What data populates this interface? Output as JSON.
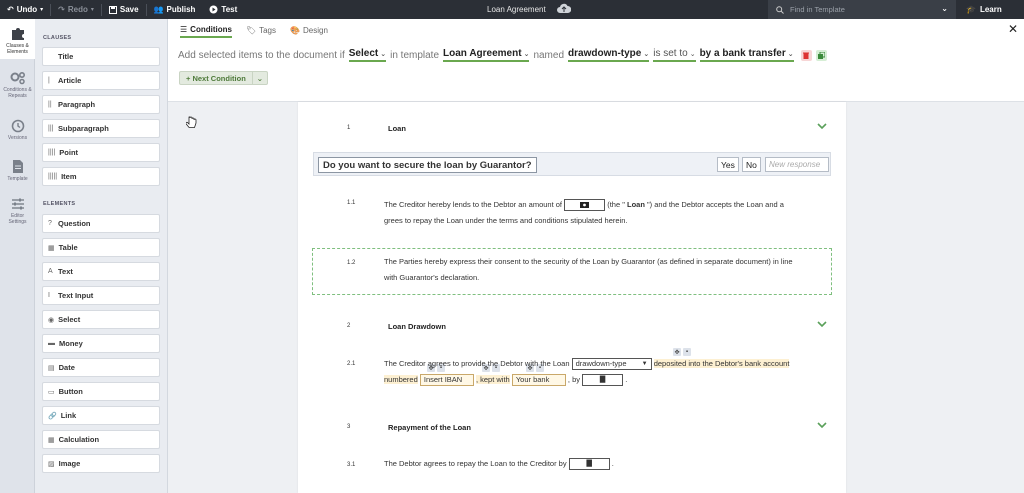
{
  "topbar": {
    "undo": "Undo",
    "redo": "Redo",
    "save": "Save",
    "publish": "Publish",
    "test": "Test",
    "document_title": "Loan Agreement",
    "search_placeholder": "Find in Template",
    "learn": "Learn"
  },
  "rail": {
    "items": [
      {
        "label1": "Clauses &",
        "label2": "Elements",
        "icon": "puzzle-icon"
      },
      {
        "label1": "Conditions &",
        "label2": "Repeats",
        "icon": "gears-icon"
      },
      {
        "label1": "Versions",
        "label2": "",
        "icon": "history-icon"
      },
      {
        "label1": "Template",
        "label2": "",
        "icon": "file-icon"
      },
      {
        "label1": "Editor",
        "label2": "Settings",
        "icon": "sliders-icon"
      }
    ]
  },
  "palette": {
    "clauses_heading": "CLAUSES",
    "clauses": [
      {
        "icon": "",
        "label": "Title"
      },
      {
        "icon": "|",
        "label": "Article"
      },
      {
        "icon": "||",
        "label": "Paragraph"
      },
      {
        "icon": "|||",
        "label": "Subparagraph"
      },
      {
        "icon": "||||",
        "label": "Point"
      },
      {
        "icon": "|||||",
        "label": "Item"
      }
    ],
    "elements_heading": "ELEMENTS",
    "elements": [
      {
        "icon": "?",
        "label": "Question"
      },
      {
        "icon": "▦",
        "label": "Table"
      },
      {
        "icon": "A",
        "label": "Text"
      },
      {
        "icon": "I",
        "label": "Text Input"
      },
      {
        "icon": "◉",
        "label": "Select"
      },
      {
        "icon": "▬",
        "label": "Money"
      },
      {
        "icon": "▤",
        "label": "Date"
      },
      {
        "icon": "▭",
        "label": "Button"
      },
      {
        "icon": "🔗",
        "label": "Link"
      },
      {
        "icon": "▦",
        "label": "Calculation"
      },
      {
        "icon": "▨",
        "label": "Image"
      }
    ]
  },
  "conditions": {
    "tabs": [
      {
        "label": "Conditions",
        "active": true
      },
      {
        "label": "Tags",
        "active": false
      },
      {
        "label": "Design",
        "active": false
      }
    ],
    "line": {
      "prefix": "Add selected items to the document if",
      "select": "Select",
      "in_template": "in template",
      "template": "Loan Agreement",
      "named": "named",
      "field": "drawdown-type",
      "is_set_to": "is set to",
      "value": "by a bank transfer"
    },
    "next_condition": "+ Next Condition"
  },
  "document": {
    "sections": [
      {
        "num": "1",
        "title": "Loan"
      },
      {
        "num": "2",
        "title": "Loan Drawdown"
      },
      {
        "num": "3",
        "title": "Repayment of the Loan"
      }
    ],
    "question": {
      "text": "Do you want to secure the loan by Guarantor?",
      "yes": "Yes",
      "no": "No",
      "new_placeholder": "New response"
    },
    "p11": {
      "num": "1.1",
      "a": "The Creditor hereby lends to the Debtor an amount of",
      "b": "(the \"",
      "term": "Loan",
      "c": "\") and the Debtor accepts the Loan and a",
      "d": "grees to repay the Loan under the terms and conditions stipulated herein."
    },
    "p12": {
      "num": "1.2",
      "a": "The Parties hereby express their consent to the security of the Loan by Guarantor (as defined in separate document) in line",
      "b": "with Guarantor's declaration."
    },
    "p21": {
      "num": "2.1",
      "a": "The Creditor agrees to provide the Debtor with the Loan",
      "select_value": "drawdown-type",
      "b": "deposited into the Debtor's bank account",
      "c": "numbered",
      "iban": "Insert IBAN",
      "d": ", kept with",
      "bank": "Your bank",
      "e": ", by",
      "f": "."
    },
    "p31": {
      "num": "3.1",
      "a": "The Debtor agrees to repay the Loan to the Creditor by",
      "b": "."
    }
  },
  "colors": {
    "accent_green": "#6aa84f",
    "topbar": "#2b2f36",
    "highlight": "#fdf0d2"
  }
}
